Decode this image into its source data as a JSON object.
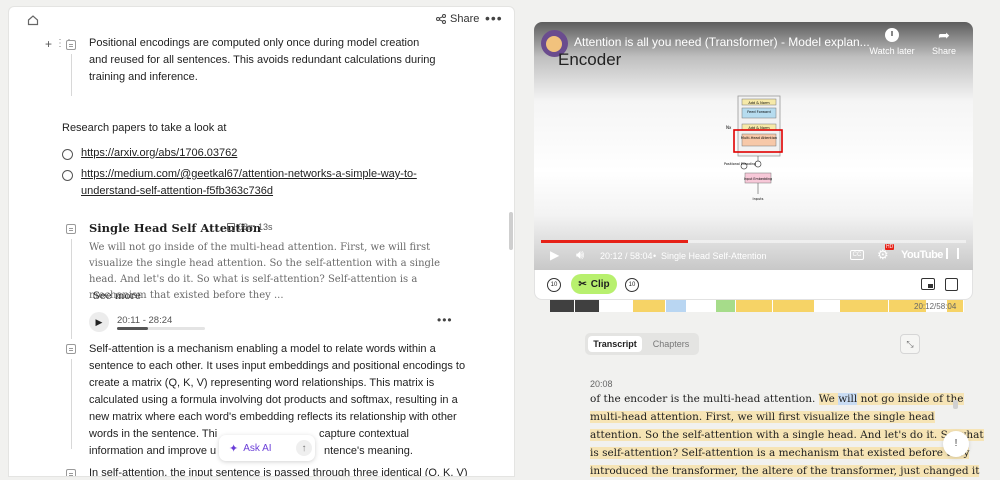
{
  "doc": {
    "share_label": "Share",
    "intro": "Positional encodings are computed only once during model creation and reused for all sentences. This avoids redundant calculations during training and inference.",
    "research_heading": "Research papers to take a look at",
    "links": [
      "https://arxiv.org/abs/1706.03762",
      "https://medium.com/@geetkal67/attention-networks-a-simple-way-to-understand-self-attention-f5fb363c736d"
    ],
    "clip_card": {
      "title": "Single Head Self Attention",
      "duration": "08m 13s",
      "excerpt": "We will not go inside of the multi-head attention. First, we will first visualize the single head attention. So the self-attention with a single head. And let's do it. So what is self-attention? Self-attention is a mechanism that existed before they ...",
      "see_more": "See more",
      "range": "20:11 - 28:24",
      "progress": 0.35
    },
    "body_lines": [
      "Self-attention is a mechanism enabling a model to relate words within a",
      "sentence to each other. It uses input embeddings and positional encodings to",
      "create a matrix (Q, K, V) representing word relationships. This matrix is",
      "calculated using a formula involving dot products and softmax, resulting in a",
      "new matrix where each word's embedding reflects its relationship with other",
      "words in the sentence. Thi",
      "capture contextual",
      "information and improve u",
      "ntence's meaning.",
      "In self-attention, the input sentence is passed through three identical (Q, K, V)"
    ],
    "ask_ai": "Ask AI"
  },
  "video": {
    "title": "Attention is all you need (Transformer) - Model explan...",
    "watch_later": "Watch later",
    "share": "Share",
    "slide_heading": "Encoder",
    "diagram": {
      "add_norm": "Add & Norm",
      "feed_forward": "Feed Forward",
      "multi_head": "Multi-Head Attention",
      "nx": "Nx",
      "positional": "Positional Encoding",
      "input_embedding": "Input Embedding",
      "inputs": "Inputs"
    },
    "time": "20:12 / 58:04",
    "chapter": "Single Head Self-Attention",
    "progress": 0.347,
    "youtube": "YouTube",
    "hd": "HD"
  },
  "clipbar": {
    "back_label": "10",
    "fwd_label": "10",
    "clip_label": "Clip",
    "timestamp": "20:12/58:04"
  },
  "chapter_colors": [
    "#404040",
    "#404040",
    "#ffffff",
    "#f6d366",
    "#b9d6f2",
    "#ffffff",
    "#a6dc8a",
    "#f6d366",
    "#f6d366",
    "#ffffff",
    "#f6d366",
    "#f6d366",
    "#ffffff",
    "#f6d366"
  ],
  "tabs": [
    "Transcript",
    "Chapters"
  ],
  "transcript": {
    "time": "20:08",
    "l1a": "of the encoder is the multi-head attention. ",
    "l1b": "We ",
    "l1c": "will",
    "l1d": " not go inside of the",
    "l2": "multi-head attention. First, we will first visualize the single head",
    "l3": "attention. So the self-attention with a single head. And let's do it. So what",
    "l4": "is self-attention? Self-attention is a mechanism that existed before they",
    "l5": "introduced the transformer, the altere of the transformer, just changed it"
  }
}
